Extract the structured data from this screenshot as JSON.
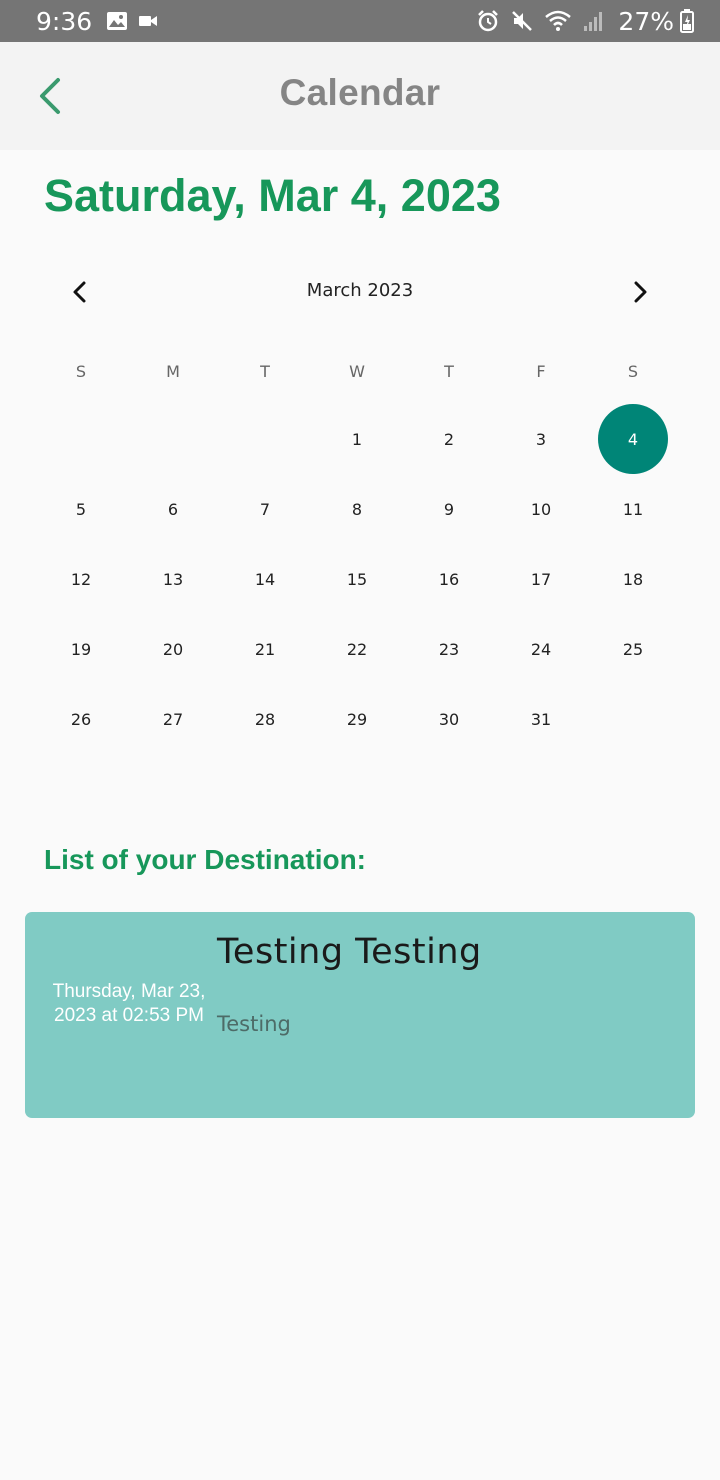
{
  "status_bar": {
    "time": "9:36",
    "battery": "27%",
    "icons": [
      "image-icon",
      "video-icon",
      "alarm-icon",
      "mute-icon",
      "wifi-icon",
      "signal-icon",
      "battery-icon"
    ]
  },
  "app_bar": {
    "title": "Calendar",
    "back_icon": "chevron-left-icon"
  },
  "selected_date": "Saturday, Mar 4, 2023",
  "calendar": {
    "month_label": "March 2023",
    "prev_icon": "chevron-left-icon",
    "next_icon": "chevron-right-icon",
    "weekdays": [
      "S",
      "M",
      "T",
      "W",
      "T",
      "F",
      "S"
    ],
    "days": [
      "",
      "",
      "",
      "1",
      "2",
      "3",
      "4",
      "5",
      "6",
      "7",
      "8",
      "9",
      "10",
      "11",
      "12",
      "13",
      "14",
      "15",
      "16",
      "17",
      "18",
      "19",
      "20",
      "21",
      "22",
      "23",
      "24",
      "25",
      "26",
      "27",
      "28",
      "29",
      "30",
      "31",
      ""
    ],
    "selected_day": "4"
  },
  "destinations": {
    "heading": "List of your Destination:",
    "items": [
      {
        "date": "Thursday, Mar 23, 2023 at 02:53 PM",
        "title": "Testing Testing",
        "description": "Testing"
      }
    ]
  },
  "colors": {
    "accent": "#17975a",
    "selected_day": "#008577",
    "card": "#80cbc4",
    "status_bar": "#757575",
    "app_bar": "#f3f3f3"
  }
}
